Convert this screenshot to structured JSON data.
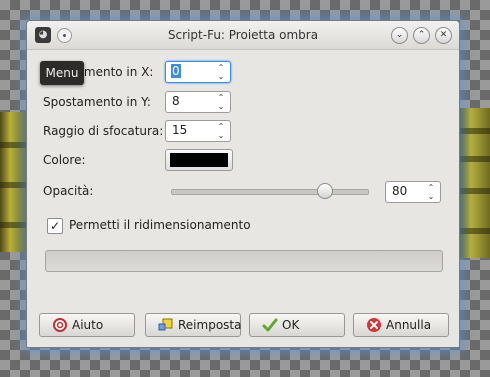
{
  "window": {
    "title": "Script-Fu: Proietta ombra",
    "controls": [
      "minimize",
      "maximize",
      "close"
    ]
  },
  "tooltip": "Menu",
  "fields": [
    {
      "label": "Spostamento in X:",
      "value": "0",
      "selected": true
    },
    {
      "label": "Spostamento in Y:",
      "value": "8"
    },
    {
      "label": "Raggio di sfocatura:",
      "value": "15"
    },
    {
      "label": "Colore:",
      "color": "#000000"
    },
    {
      "label": "Opacità:",
      "value": "80",
      "slider_fraction": 0.8
    }
  ],
  "checkbox": {
    "label": "Permetti il ridimensionamento",
    "checked": true
  },
  "buttons": {
    "help": "Aiuto",
    "reset": "Reimposta",
    "ok": "OK",
    "cancel": "Annulla"
  },
  "colors": {
    "selection": "#3d8ee0",
    "window_glow": "#5096e6"
  }
}
